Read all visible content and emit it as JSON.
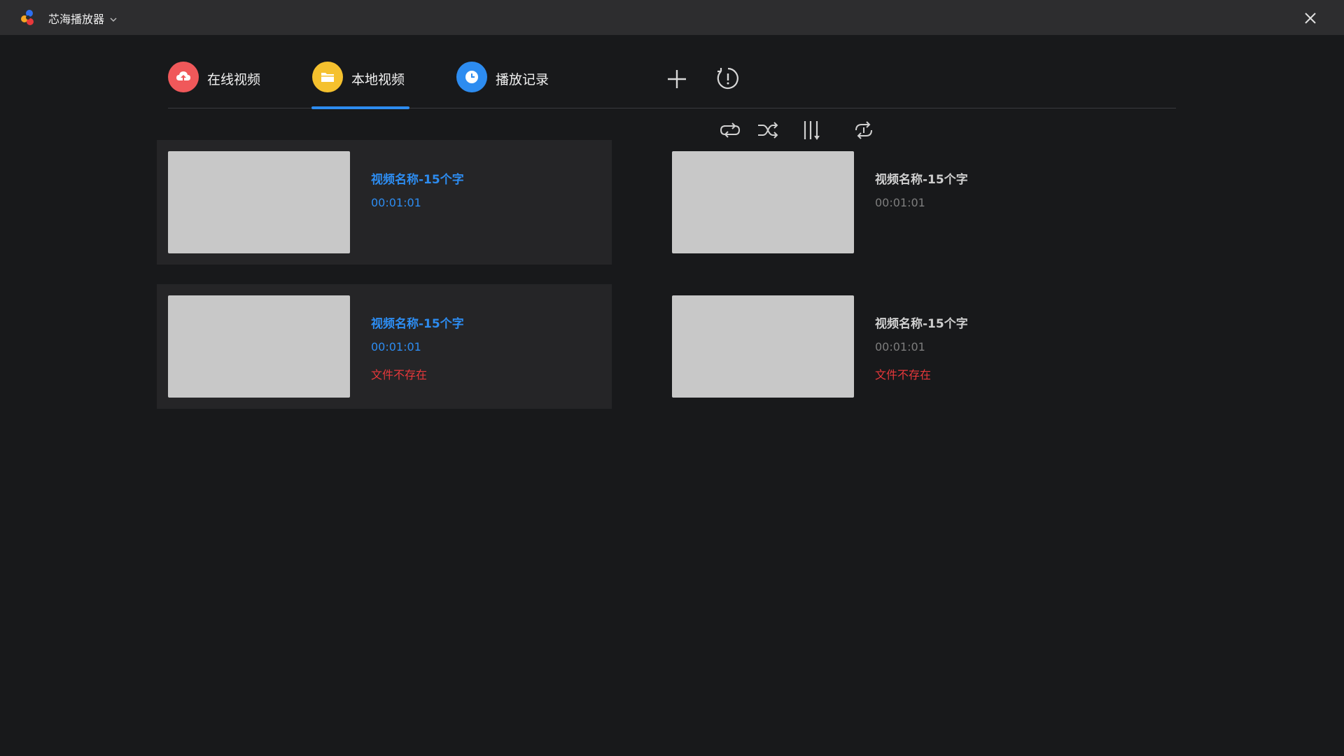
{
  "titlebar": {
    "app_title": "芯海播放器",
    "logo_icon": "app-logo-icon",
    "menu_icon": "chevron-down-icon",
    "close_icon": "close-icon"
  },
  "tabs": [
    {
      "label": "在线视频",
      "icon": "cloud-upload-icon",
      "color": "#f0585a"
    },
    {
      "label": "本地视频",
      "icon": "folder-icon",
      "color": "#f5c12e",
      "active": true
    },
    {
      "label": "播放记录",
      "icon": "clock-icon",
      "color": "#2d8cf0"
    }
  ],
  "toolbar": {
    "add_icon": "plus-icon",
    "info_icon": "info-icon"
  },
  "playback_controls": [
    "loop-icon",
    "shuffle-icon",
    "order-icon",
    "single-loop-icon"
  ],
  "accent_color": "#2d8cf0",
  "error_color": "#e8383b",
  "videos": [
    {
      "name": "视频名称-15个字",
      "duration": "00:01:01",
      "status": "",
      "selected": true
    },
    {
      "name": "视频名称-15个字",
      "duration": "00:01:01",
      "status": "",
      "selected": false
    },
    {
      "name": "视频名称-15个字",
      "duration": "00:01:01",
      "status": "文件不存在",
      "selected": true
    },
    {
      "name": "视频名称-15个字",
      "duration": "00:01:01",
      "status": "文件不存在",
      "selected": false
    }
  ]
}
